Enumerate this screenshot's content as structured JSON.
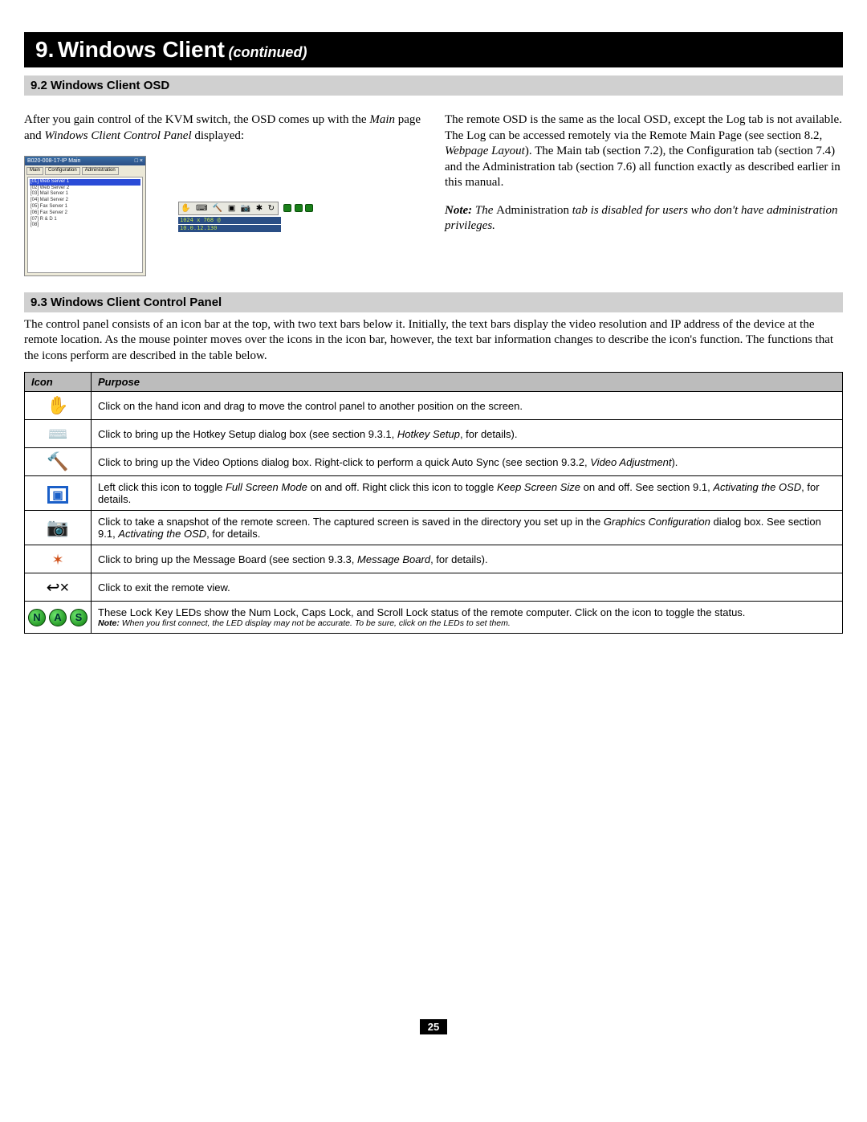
{
  "chapter": {
    "number": "9.",
    "title": "Windows Client",
    "suffix": "(continued)"
  },
  "sec92": {
    "heading": "9.2 Windows Client OSD",
    "left_p1_a": "After you gain control of the KVM switch, the OSD comes up with the ",
    "left_p1_main": "Main",
    "left_p1_b": " page and ",
    "left_p1_wccp": "Windows Client Control Panel",
    "left_p1_c": " displayed:",
    "right_p1_a": "The remote OSD is the same as the local OSD, except the Log tab is not available. The Log can be accessed remotely via the Remote Main Page (see section 8.2, ",
    "right_p1_i1": "Webpage Layout",
    "right_p1_b": "). The Main tab (section 7.2), the Configuration tab (section 7.4) and the Administration tab (section 7.6) all function exactly as described earlier in this manual.",
    "note_label": "Note:",
    "note_lead": " The ",
    "note_admin": "Administration",
    "note_tail": " tab is disabled for users who don't have administration privileges."
  },
  "osd": {
    "title": "B020-008-17-IP Main",
    "tabs": [
      "Main",
      "Configuration",
      "Administration"
    ],
    "items": [
      "[01] Web Server 1",
      "[02] Web Server 2",
      "[03] Mail Server 1",
      "[04] Mail Server 2",
      "[05] Fax Server 1",
      "[06] Fax Server 2",
      "[07] R & D 1",
      "[08]"
    ],
    "res": "1024 x 768 @",
    "ip": "10.0.12.130"
  },
  "sec93": {
    "heading": "9.3 Windows Client Control Panel",
    "intro": "The control panel consists of an icon bar at the top, with two text bars below it. Initially, the text bars display the video resolution and IP address of the device at the remote location. As the mouse pointer moves over the icons in the icon bar, however, the text bar information changes to describe the icon's function. The functions that the icons perform are described in the table below."
  },
  "table": {
    "headers": {
      "icon": "Icon",
      "purpose": "Purpose"
    },
    "rows": [
      {
        "icon": "hand-icon",
        "parts": [
          {
            "t": "Click on the hand icon and drag to move the control panel to another position on the screen."
          }
        ]
      },
      {
        "icon": "keyboard-icon",
        "parts": [
          {
            "t": "Click to bring up the Hotkey Setup dialog box (see section 9.3.1, "
          },
          {
            "t": "Hotkey Setup",
            "i": true
          },
          {
            "t": ", for details)."
          }
        ]
      },
      {
        "icon": "hammer-icon",
        "parts": [
          {
            "t": "Click to bring up the Video Options dialog box. Right-click to perform a quick Auto Sync (see section 9.3.2, "
          },
          {
            "t": "Video Adjustment",
            "i": true
          },
          {
            "t": ")."
          }
        ]
      },
      {
        "icon": "fullscreen-icon",
        "parts": [
          {
            "t": "Left click this icon to toggle "
          },
          {
            "t": "Full Screen Mode",
            "i": true
          },
          {
            "t": " on and off. Right click this icon to toggle "
          },
          {
            "t": "Keep Screen Size",
            "i": true
          },
          {
            "t": " on and off. See section 9.1, "
          },
          {
            "t": "Activating the OSD",
            "i": true
          },
          {
            "t": ", for details."
          }
        ]
      },
      {
        "icon": "camera-icon",
        "parts": [
          {
            "t": "Click to take a snapshot of the remote screen. The captured screen is saved in the directory you set up in the "
          },
          {
            "t": "Graphics Configuration",
            "i": true
          },
          {
            "t": " dialog box. See section 9.1, "
          },
          {
            "t": "Activating the OSD",
            "i": true
          },
          {
            "t": ", for details."
          }
        ]
      },
      {
        "icon": "message-icon",
        "parts": [
          {
            "t": "Click to bring up the Message Board (see section 9.3.3, "
          },
          {
            "t": "Message Board",
            "i": true
          },
          {
            "t": ", for details)."
          }
        ]
      },
      {
        "icon": "exit-icon",
        "parts": [
          {
            "t": "Click to exit the remote view."
          }
        ]
      },
      {
        "icon": "lock-leds-icon",
        "parts": [
          {
            "t": "These Lock Key LEDs show the Num Lock, Caps Lock, and Scroll Lock status of the remote computer. Click on the icon to toggle the status."
          }
        ],
        "note_label": "Note:",
        "note": " When you first connect, the LED display may not be accurate. To be sure, click on the LEDs to set them."
      }
    ]
  },
  "leds": [
    "N",
    "A",
    "S"
  ],
  "page_number": "25"
}
